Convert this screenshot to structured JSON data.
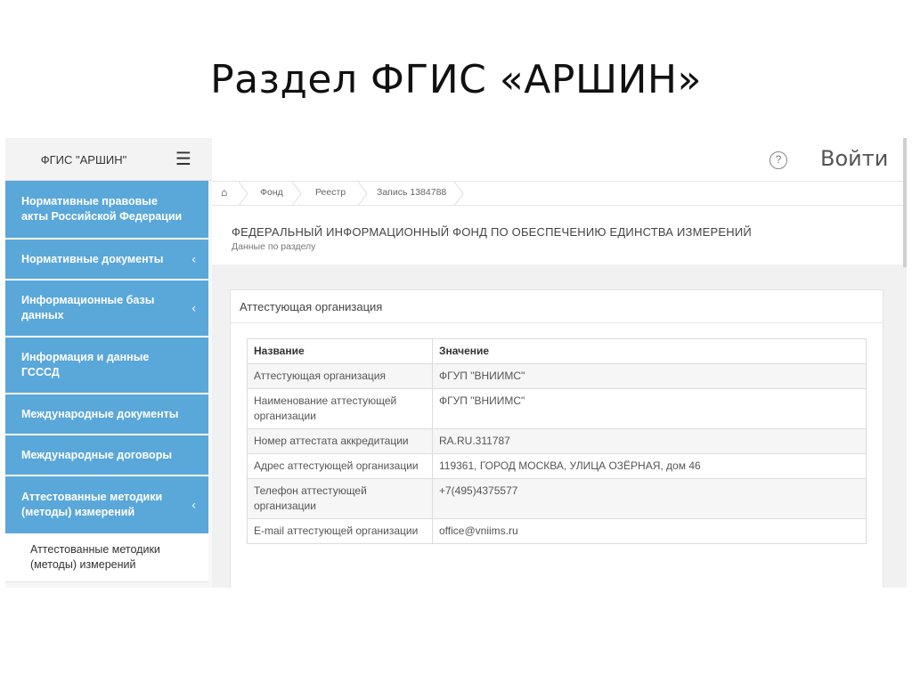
{
  "slide": {
    "title": "Раздел ФГИС «АРШИН»"
  },
  "sidebar": {
    "brand": "ФГИС \"АРШИН\"",
    "menu_icon": "hamburger-icon",
    "items": [
      {
        "label": "Нормативные правовые акты Российской Федерации",
        "chevron": ""
      },
      {
        "label": "Нормативные документы",
        "chevron": "‹"
      },
      {
        "label": "Информационные базы данных",
        "chevron": "‹"
      },
      {
        "label": "Информация и данные ГСССД",
        "chevron": ""
      },
      {
        "label": "Международные документы",
        "chevron": ""
      },
      {
        "label": "Международные договоры",
        "chevron": ""
      },
      {
        "label": "Аттестованные методики (методы) измерений",
        "chevron": "‹"
      }
    ],
    "subitem": "Аттестованные методики (методы) измерений",
    "accent_color": "#5aa7d9"
  },
  "topbar": {
    "help": "?",
    "login": "Войти"
  },
  "breadcrumb": {
    "home_icon": "home-icon",
    "items": [
      "Фонд",
      "Реестр",
      "Запись 1384788"
    ]
  },
  "page": {
    "title": "ФЕДЕРАЛЬНЫЙ ИНФОРМАЦИОННЫЙ ФОНД ПО ОБЕСПЕЧЕНИЮ ЕДИНСТВА ИЗМЕРЕНИЙ",
    "subtitle": "Данные по разделу"
  },
  "panel": {
    "title": "Аттестующая организация",
    "columns": [
      "Название",
      "Значение"
    ],
    "rows": [
      [
        "Аттестующая организация",
        "ФГУП \"ВНИИМС\""
      ],
      [
        "Наименование аттестующей организации",
        "ФГУП \"ВНИИМС\""
      ],
      [
        "Номер аттестата аккредитации",
        "RA.RU.311787"
      ],
      [
        "Адрес аттестующей организации",
        "119361, ГОРОД МОСКВА, УЛИЦА ОЗЁРНАЯ, дом 46"
      ],
      [
        "Телефон аттестующей организации",
        "+7(495)4375577"
      ],
      [
        "E-mail аттестующей организации",
        "office@vniims.ru"
      ]
    ]
  }
}
